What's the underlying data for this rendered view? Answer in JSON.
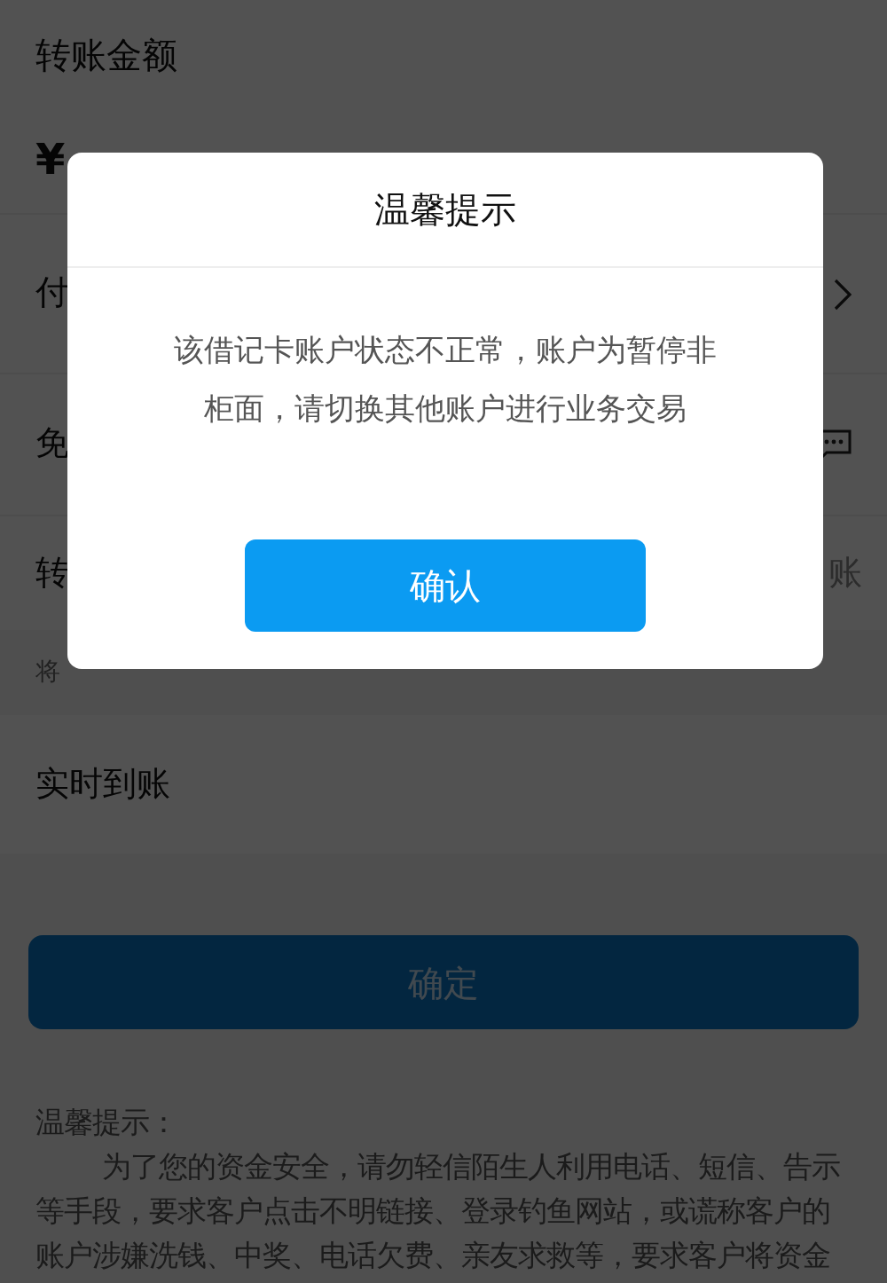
{
  "page": {
    "title": "转账金额",
    "currency": "¥",
    "rows": [
      {
        "kind": "chevron",
        "label": "付"
      },
      {
        "kind": "message",
        "label": "免"
      },
      {
        "kind": "value",
        "label": "转",
        "value": "账"
      }
    ],
    "band_label": "将",
    "arrival": "实时到账",
    "submit_button": "确定",
    "tips_title": "温馨提示：",
    "tips_text": "为了您的资金安全，请勿轻信陌生人利用电话、短信、告示等手段，要求客户点击不明链接、登录钓鱼网站，或谎称客户的账户涉嫌洗钱、中奖、电话欠费、亲友求救等，要求客户将资金"
  },
  "dialog": {
    "title": "温馨提示",
    "message": "该借记卡账户状态不正常，账户为暂停非柜面，请切换其他账户进行业务交易",
    "confirm_button": "确认"
  }
}
